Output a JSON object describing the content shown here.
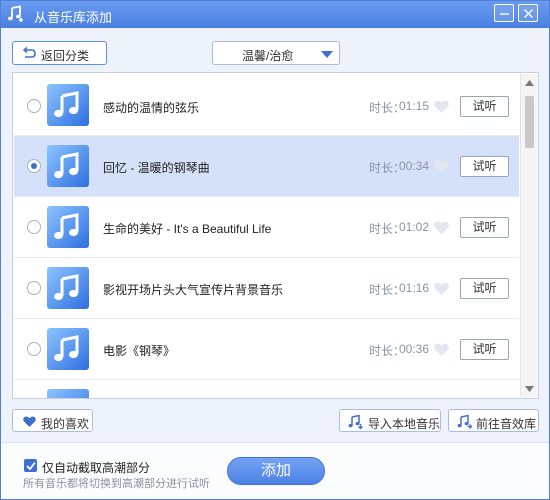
{
  "window": {
    "title": "从音乐库添加",
    "accent_color": "#4a7fe0",
    "icon": "music-add-icon"
  },
  "toolbar": {
    "back_label": "返回分类",
    "category_selected": "温馨/治愈"
  },
  "songs": [
    {
      "title": "感动的温情的弦乐",
      "duration_label": "时长：",
      "duration": "01:15",
      "listen_label": "试听",
      "selected": false
    },
    {
      "title": "回忆 - 温暖的钢琴曲",
      "duration_label": "时长：",
      "duration": "00:34",
      "listen_label": "试听",
      "selected": true
    },
    {
      "title": "生命的美好 - It's a Beautiful Life",
      "duration_label": "时长：",
      "duration": "01:02",
      "listen_label": "试听",
      "selected": false
    },
    {
      "title": "影视开场片头大气宣传片背景音乐",
      "duration_label": "时长：",
      "duration": "01:16",
      "listen_label": "试听",
      "selected": false
    },
    {
      "title": "电影《钢琴》",
      "duration_label": "时长：",
      "duration": "00:36",
      "listen_label": "试听",
      "selected": false
    }
  ],
  "bottom_actions": {
    "favorites_label": "我的喜欢",
    "import_label": "导入本地音乐",
    "library_label": "前往音效库"
  },
  "footer": {
    "auto_clip_label": "仅自动截取高潮部分",
    "auto_clip_checked": true,
    "hint": "所有音乐都将切换到高潮部分进行试听",
    "add_label": "添加"
  }
}
